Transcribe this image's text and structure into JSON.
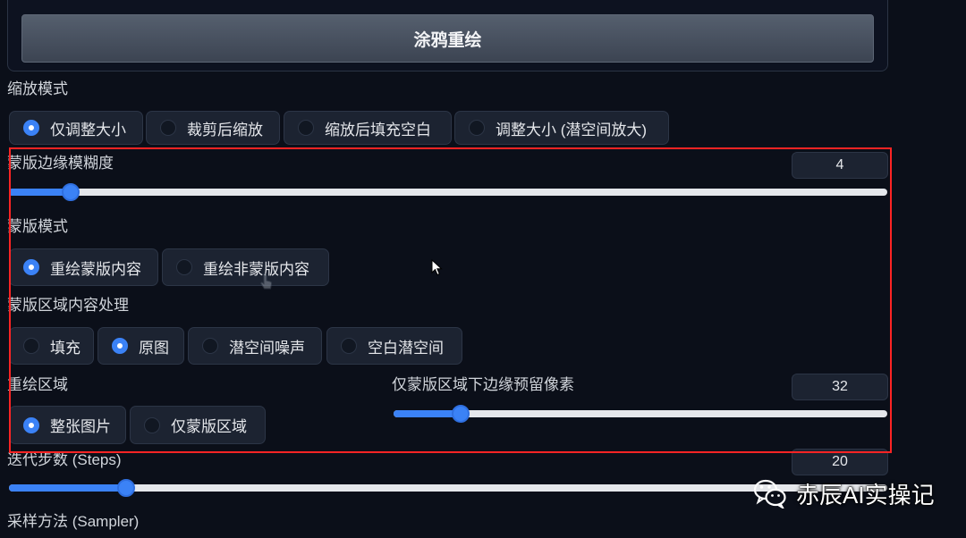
{
  "inpaint_button": {
    "label": "涂鸦重绘"
  },
  "resize_mode": {
    "label": "缩放模式",
    "options": [
      {
        "label": "仅调整大小",
        "selected": true
      },
      {
        "label": "裁剪后缩放",
        "selected": false
      },
      {
        "label": "缩放后填充空白",
        "selected": false
      },
      {
        "label": "调整大小 (潜空间放大)",
        "selected": false
      }
    ]
  },
  "mask_blur": {
    "label": "蒙版边缘模糊度",
    "value": "4",
    "level": 0.07
  },
  "mask_mode": {
    "label": "蒙版模式",
    "options": [
      {
        "label": "重绘蒙版内容",
        "selected": true
      },
      {
        "label": "重绘非蒙版内容",
        "selected": false
      }
    ]
  },
  "masked_content": {
    "label": "蒙版区域内容处理",
    "options": [
      {
        "label": "填充",
        "selected": false
      },
      {
        "label": "原图",
        "selected": true
      },
      {
        "label": "潜空间噪声",
        "selected": false
      },
      {
        "label": "空白潜空间",
        "selected": false
      }
    ]
  },
  "inpaint_area": {
    "label": "重绘区域",
    "options": [
      {
        "label": "整张图片",
        "selected": true
      },
      {
        "label": "仅蒙版区域",
        "selected": false
      }
    ]
  },
  "only_masked_padding": {
    "label": "仅蒙版区域下边缘预留像素",
    "value": "32",
    "level": 0.136
  },
  "sampling_steps": {
    "label": "迭代步数 (Steps)",
    "value": "20",
    "level": 0.133
  },
  "sampling_method": {
    "label": "采样方法 (Sampler)"
  },
  "watermark": {
    "text": "赤辰AI实操记",
    "icon": "wechat-icon"
  },
  "colors": {
    "background": "#0b0f19",
    "panel": "#1c2331",
    "accent": "#3b82f6",
    "slider_track": "#e5e7eb",
    "annotation": "#ff2424"
  }
}
